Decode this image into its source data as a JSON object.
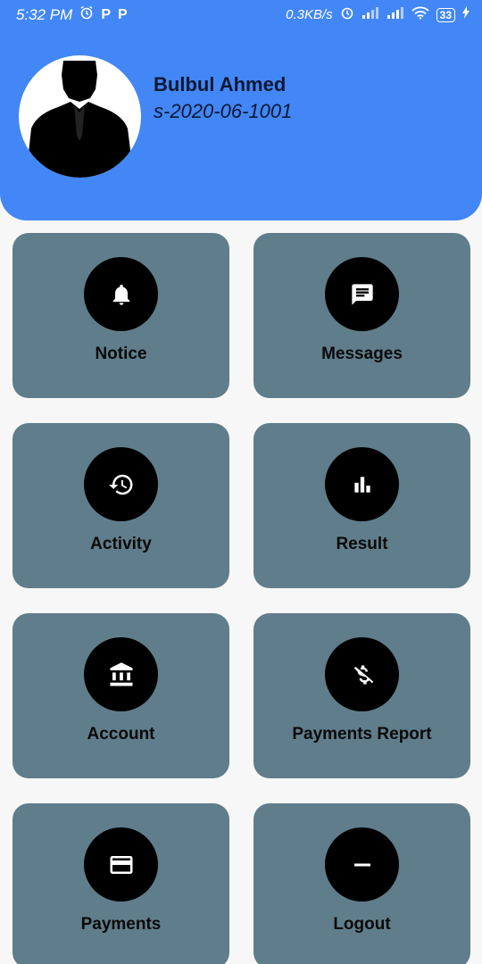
{
  "status_bar": {
    "time": "5:32 PM",
    "notif_icons": [
      "alarm-icon",
      "p-app-icon",
      "p-app-icon"
    ],
    "p_letter": "P",
    "net_speed": "0.3KB/s",
    "battery": "33"
  },
  "profile": {
    "name": "Bulbul Ahmed",
    "id": "s-2020-06-1001"
  },
  "colors": {
    "header": "#4287f5",
    "tile": "#607d8b",
    "icon_circle": "#000000",
    "background": "#f7f7f7"
  },
  "tiles": [
    {
      "label": "Notice",
      "icon": "bell-icon"
    },
    {
      "label": "Messages",
      "icon": "message-icon"
    },
    {
      "label": "Activity",
      "icon": "history-icon"
    },
    {
      "label": "Result",
      "icon": "bar-chart-icon"
    },
    {
      "label": "Account",
      "icon": "bank-icon"
    },
    {
      "label": "Payments Report",
      "icon": "money-off-icon"
    },
    {
      "label": "Payments",
      "icon": "credit-card-icon"
    },
    {
      "label": "Logout",
      "icon": "minus-icon"
    }
  ]
}
